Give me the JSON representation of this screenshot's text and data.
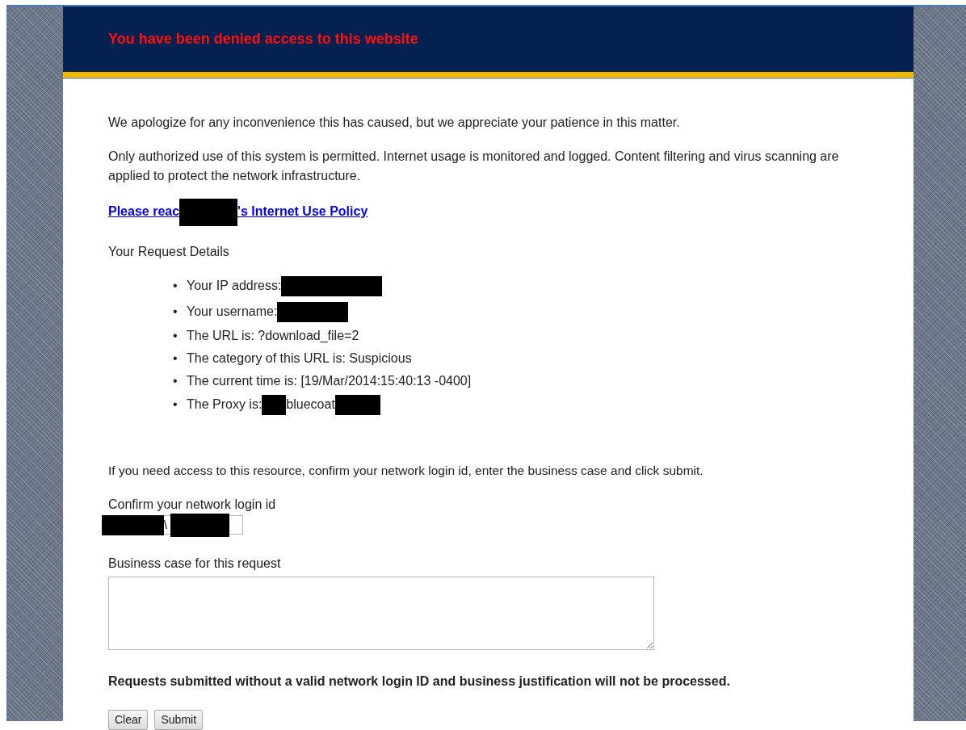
{
  "header": {
    "title": "You have been denied access to this website"
  },
  "paragraphs": [
    "We apologize for any inconvenience this has caused, but we appreciate your patience in this matter.",
    "Only authorized use of this system is permitted. Internet usage is monitored and logged. Content filtering and virus scanning are applied to protect the network infrastructure."
  ],
  "policy_link": [
    {
      "kind": "text",
      "text": "Please reac"
    },
    {
      "kind": "redaction"
    },
    {
      "kind": "text",
      "text": "'s Internet Use Policy"
    }
  ],
  "details_heading": "Your Request Details",
  "details": [
    {
      "bullet": "•",
      "parts": [
        {
          "kind": "text",
          "text": "Your IP address:"
        },
        {
          "kind": "redaction"
        }
      ]
    },
    {
      "bullet": "•",
      "parts": [
        {
          "kind": "text",
          "text": "Your username:"
        },
        {
          "kind": "redaction"
        }
      ]
    },
    {
      "bullet": "•",
      "parts": [
        {
          "kind": "text",
          "text": "The URL is: ?download_file=2"
        }
      ]
    },
    {
      "bullet": "•",
      "parts": [
        {
          "kind": "text",
          "text": "The category of this URL is: Suspicious"
        }
      ]
    },
    {
      "bullet": "•",
      "parts": [
        {
          "kind": "text",
          "text": "The current time is: [19/Mar/2014:15:40:13 -0400]"
        }
      ]
    },
    {
      "bullet": "•",
      "parts": [
        {
          "kind": "text",
          "text": "The Proxy is:"
        },
        {
          "kind": "redaction"
        },
        {
          "kind": "text",
          "text": "bluecoat"
        },
        {
          "kind": "redaction"
        }
      ]
    }
  ],
  "instructions": "If you need access to this resource, confirm your network login id, enter the business case and click submit.",
  "login_field": {
    "label": "Confirm your network login id",
    "value": "\\",
    "redacted": true
  },
  "business_case": {
    "label": "Business case for this request"
  },
  "warning": "Requests submitted without a valid network login ID and business justification will not be processed.",
  "buttons": [
    "Clear",
    "Submit"
  ]
}
